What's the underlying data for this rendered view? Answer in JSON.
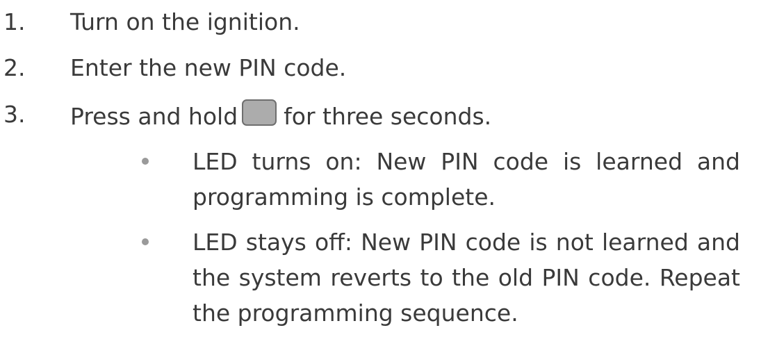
{
  "steps": [
    {
      "number": "1.",
      "text": "Turn on the ignition."
    },
    {
      "number": "2.",
      "text": "Enter the new PIN code."
    },
    {
      "number": "3.",
      "text_before": "Press and hold",
      "icon": "key-button-icon",
      "text_after": "for three seconds."
    }
  ],
  "results": [
    {
      "text": "LED turns on: New PIN code is learned and program­ming is complete."
    },
    {
      "text": "LED stays off: New PIN code is not learned and the sys­tem reverts to the old PIN code. Repeat the program­ming sequence."
    }
  ],
  "colors": {
    "text": "#3a3a3a",
    "bullet": "#9a9a9a",
    "key_fill": "#acacac",
    "key_border": "#6e6e6e"
  }
}
